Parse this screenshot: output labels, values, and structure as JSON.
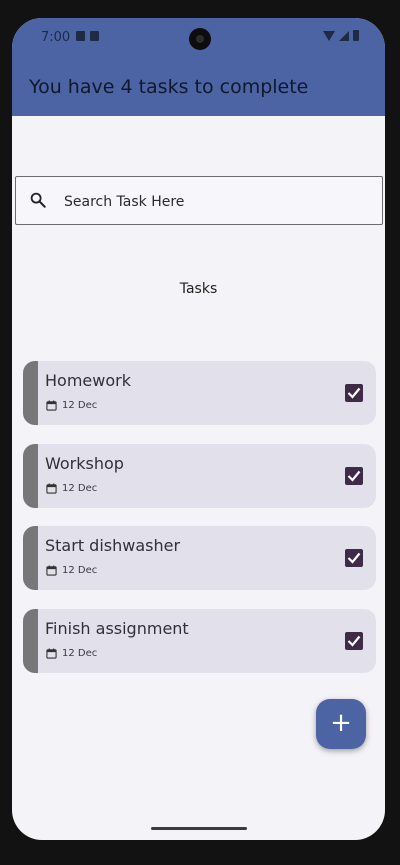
{
  "status_bar": {
    "time": "7:00"
  },
  "app_bar": {
    "title": "You have 4 tasks to complete"
  },
  "search": {
    "placeholder": "Search Task Here"
  },
  "section_title": "Tasks",
  "tasks": [
    {
      "title": "Homework",
      "date": "12 Dec",
      "checked": true
    },
    {
      "title": "Workshop",
      "date": "12 Dec",
      "checked": true
    },
    {
      "title": "Start dishwasher",
      "date": "12 Dec",
      "checked": true
    },
    {
      "title": "Finish assignment",
      "date": "12 Dec",
      "checked": true
    }
  ],
  "fab": {
    "icon": "plus-icon",
    "label": "+"
  },
  "colors": {
    "primary": "#4c64a4",
    "background": "#f4f3f7",
    "task_card": "#e2e1eb",
    "task_accent": "#777779",
    "checkbox": "#3f2b47"
  }
}
